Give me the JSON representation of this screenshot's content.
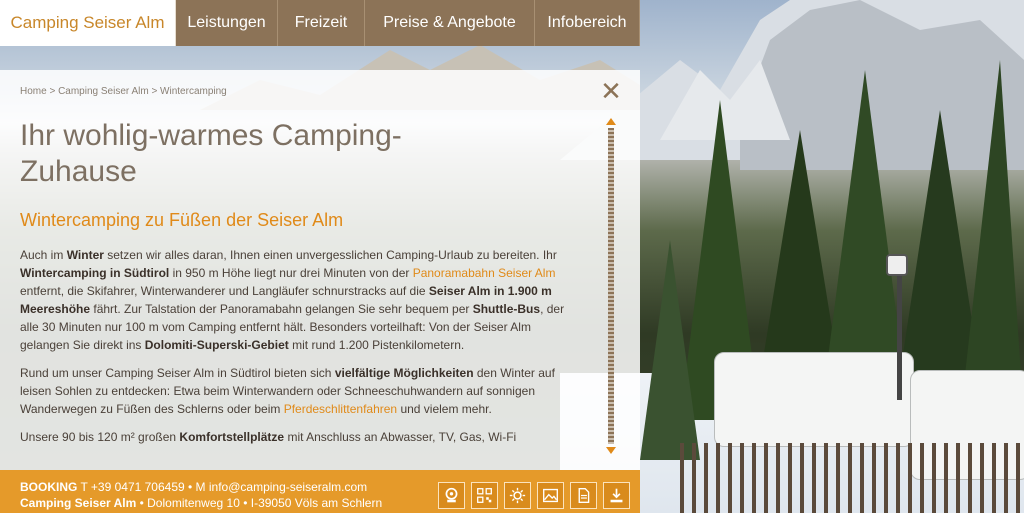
{
  "nav": {
    "brand": "Camping Seiser Alm",
    "items": [
      "Leistungen",
      "Freizeit",
      "Preise & Angebote",
      "Infobereich"
    ]
  },
  "breadcrumb": "Home > Camping Seiser Alm > Wintercamping",
  "page": {
    "title": "Ihr wohlig-warmes Camping-Zuhause",
    "subtitle": "Wintercamping zu Füßen der Seiser Alm"
  },
  "paragraphs": {
    "p1": {
      "t1": "Auch im ",
      "b1": "Winter",
      "t2": " setzen wir alles daran, Ihnen einen unvergesslichen Camping-Urlaub zu bereiten. Ihr ",
      "b2": "Wintercamping in Südtirol",
      "t3": " in 950 m Höhe liegt nur drei Minuten von der ",
      "a1": "Panoramabahn Seiser Alm",
      "t4": " entfernt, die Skifahrer, Winterwanderer und Langläufer schnurstracks auf die ",
      "b3": "Seiser Alm in 1.900 m Meereshöhe",
      "t5": " fährt. Zur Talstation der Panoramabahn gelangen Sie sehr bequem per ",
      "b4": "Shuttle-Bus",
      "t6": ", der alle 30 Minuten nur 100 m vom Camping entfernt hält. Besonders vorteilhaft: Von der Seiser Alm gelangen Sie direkt ins ",
      "b5": "Dolomiti-Superski-Gebiet",
      "t7": " mit rund 1.200 Pistenkilometern."
    },
    "p2": {
      "t1": "Rund um unser Camping Seiser Alm in Südtirol bieten sich ",
      "b1": "vielfältige Möglichkeiten",
      "t2": " den Winter auf leisen Sohlen zu entdecken: Etwa beim Winterwandern oder Schneeschuhwandern auf sonnigen Wanderwegen zu Füßen des Schlerns oder beim ",
      "a1": "Pferdeschlittenfahren",
      "t3": " und vielem mehr."
    },
    "p3": {
      "t1": "Unsere 90 bis 120 m² großen ",
      "b1": "Komfortstellplätze",
      "t2": " mit Anschluss an Abwasser, TV, Gas, Wi-Fi"
    }
  },
  "footer": {
    "booking_label": "BOOKING",
    "contact": "T +39 0471 706459 • M info@camping-seiseralm.com",
    "name": "Camping Seiser Alm",
    "address": "• Dolomitenweg 10 • I-39050 Völs am Schlern",
    "icons": [
      "webcam-icon",
      "qr-code-icon",
      "weather-icon",
      "gallery-icon",
      "document-icon",
      "download-icon"
    ]
  },
  "colors": {
    "accent": "#e08a19",
    "nav_bg": "#8c7357",
    "footer_bg": "#e59a2a",
    "title": "#7d7062"
  }
}
